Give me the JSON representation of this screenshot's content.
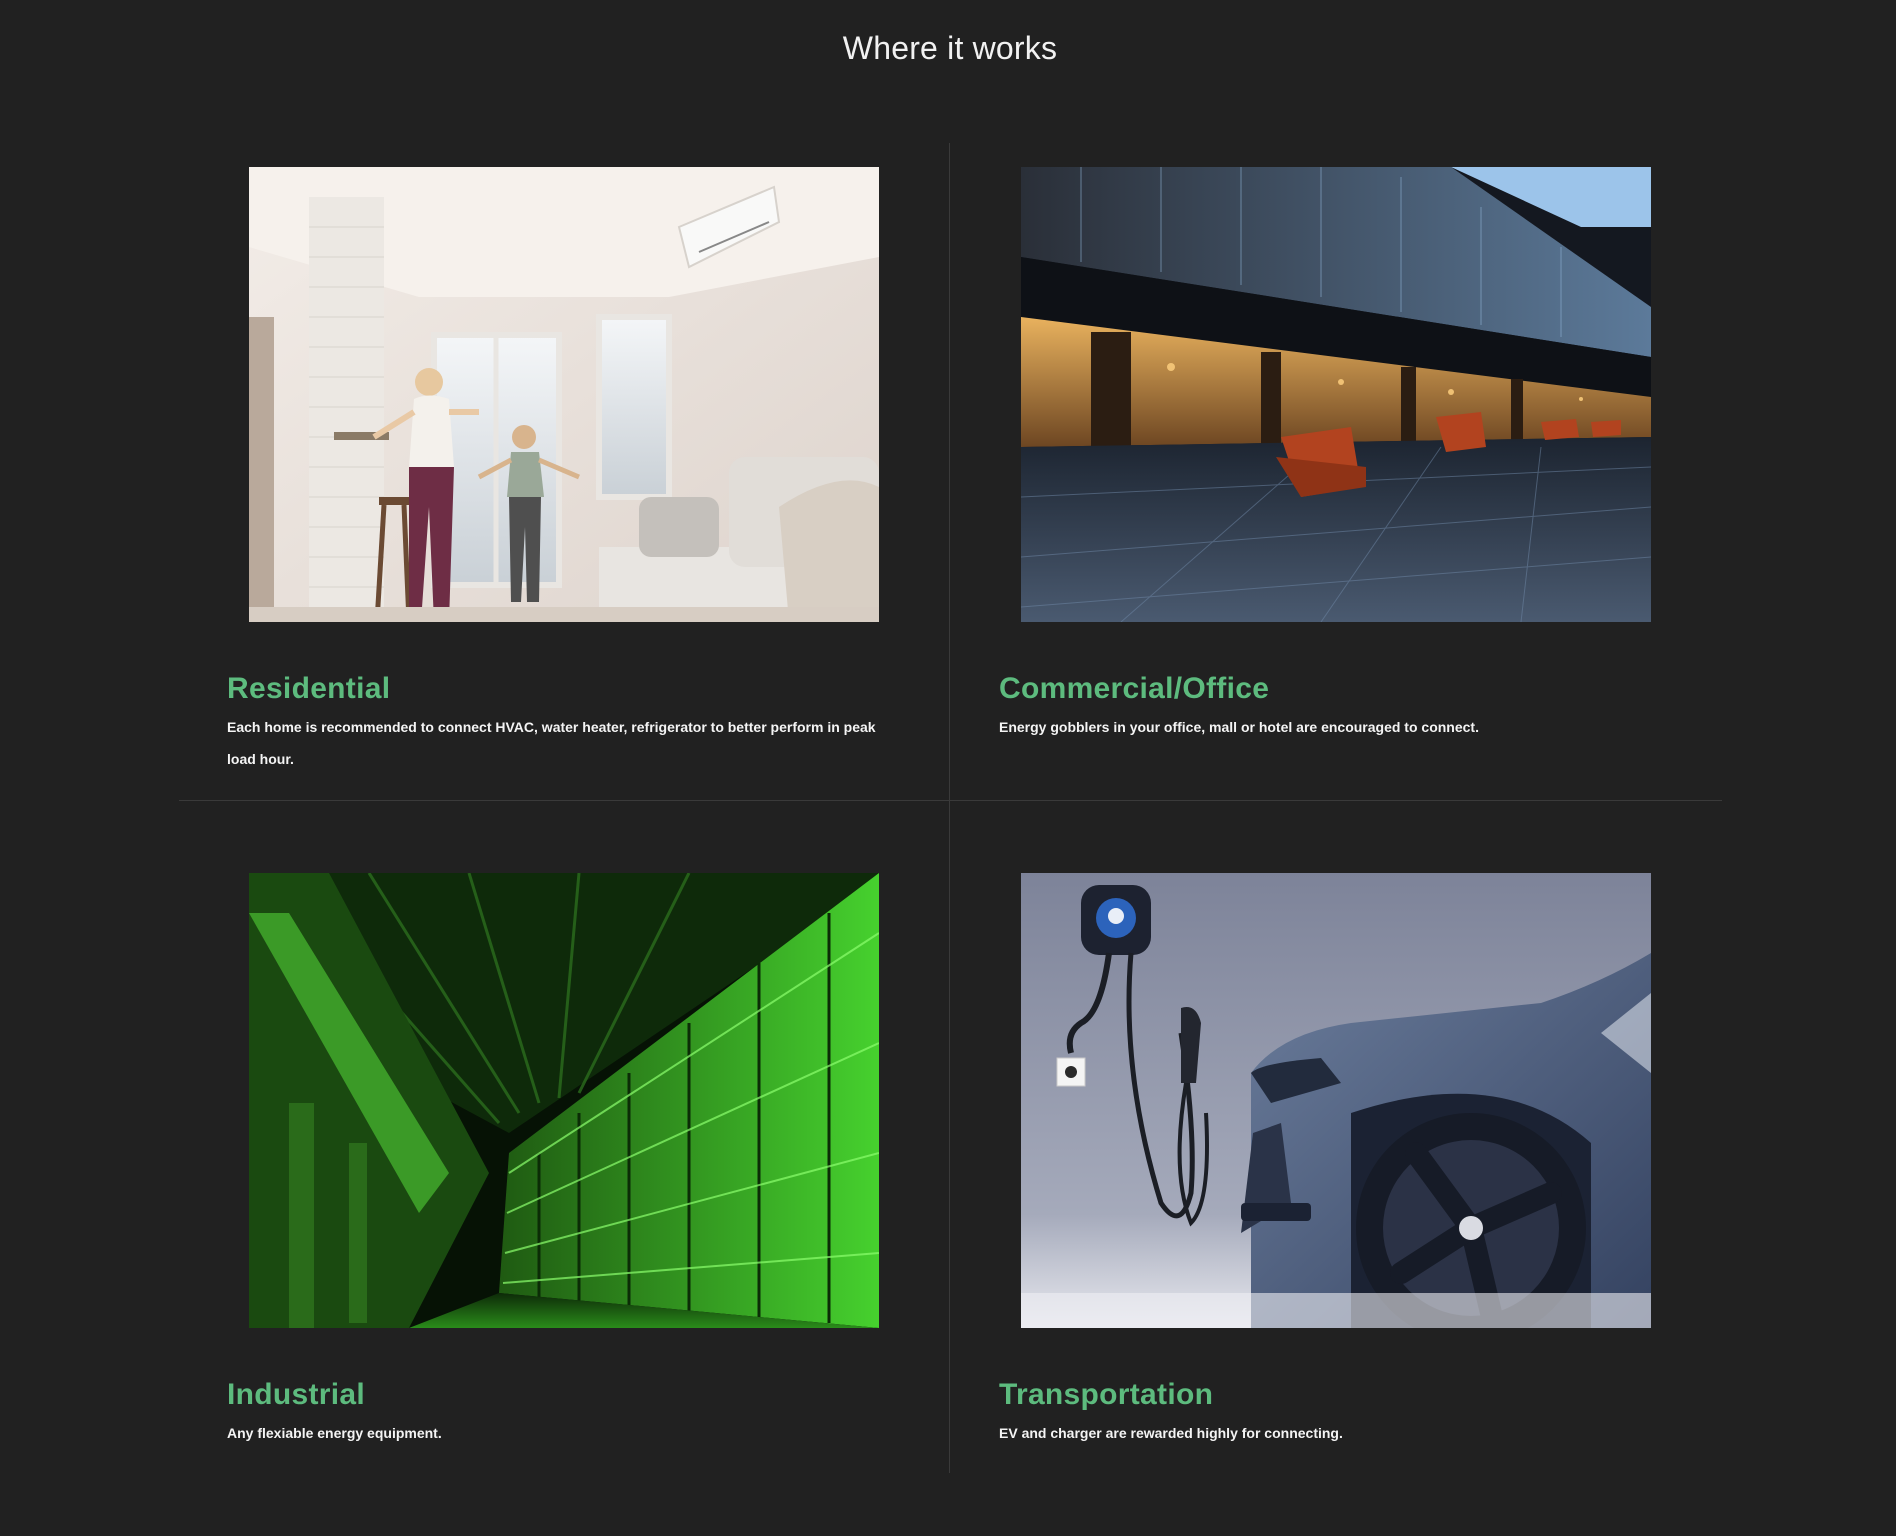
{
  "page": {
    "title": "Where it works",
    "background": "#212121",
    "accent": "#5dbb7e"
  },
  "cards": [
    {
      "title": "Residential",
      "description": "Each home is recommended to connect HVAC, water heater, refrigerator to better perform in peak load hour.",
      "image": "family-in-bright-living-room-with-air-conditioner"
    },
    {
      "title": "Commercial/Office",
      "description": "Energy gobblers in your office, mall or hotel are encouraged to connect.",
      "image": "modern-office-atrium-with-orange-lounge-chairs"
    },
    {
      "title": "Industrial",
      "description": "Any flexiable energy equipment.",
      "image": "green-lit-data-center-server-racks"
    },
    {
      "title": "Transportation",
      "description": "EV and charger are rewarded highly for connecting.",
      "image": "ev-wall-charger-and-blue-electric-car"
    }
  ]
}
